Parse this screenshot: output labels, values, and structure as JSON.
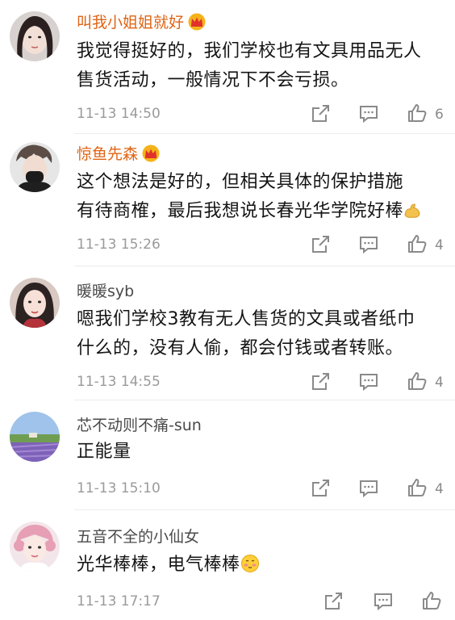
{
  "comments": [
    {
      "name": "叫我小姐姐就好",
      "vip": true,
      "text_line1": "我觉得挺好的，我们学校也有文具用品无人",
      "text_line2": "售货活动，一般情况下不会亏损。",
      "time": "11-13 14:50",
      "likes": "6"
    },
    {
      "name": "惊鱼先森",
      "vip": true,
      "text_line1": "这个想法是好的，但相关具体的保护措施",
      "text_line2": "有待商榷，最后我想说长春光华学院好棒",
      "emoji": "flexed-bicep-emoji",
      "time": "11-13 15:26",
      "likes": "4"
    },
    {
      "name": "暖暖syb",
      "vip": false,
      "text_line1": "嗯我们学校3教有无人售货的文具或者纸巾",
      "text_line2": "什么的，没有人偷，都会付钱或者转账。",
      "time": "11-13 14:55",
      "likes": "4"
    },
    {
      "name": "芯不动则不痛-sun",
      "vip": false,
      "text_line1": "正能量",
      "time": "11-13 15:10",
      "likes": "4"
    },
    {
      "name": "五音不全的小仙女",
      "vip": false,
      "text_line1": "光华棒棒，电气棒棒",
      "emoji": "shy-face-emoji",
      "time": "11-13 17:17",
      "likes": ""
    }
  ],
  "colors": {
    "vip_name": "#e06414",
    "normal_name": "#4a4a4a",
    "time": "#9a9a9a",
    "icon": "#8a8a8a"
  },
  "icons": {
    "share": "share-icon",
    "reply": "comment-icon",
    "like": "thumbs-up-icon",
    "crown": "vip-crown-icon"
  }
}
